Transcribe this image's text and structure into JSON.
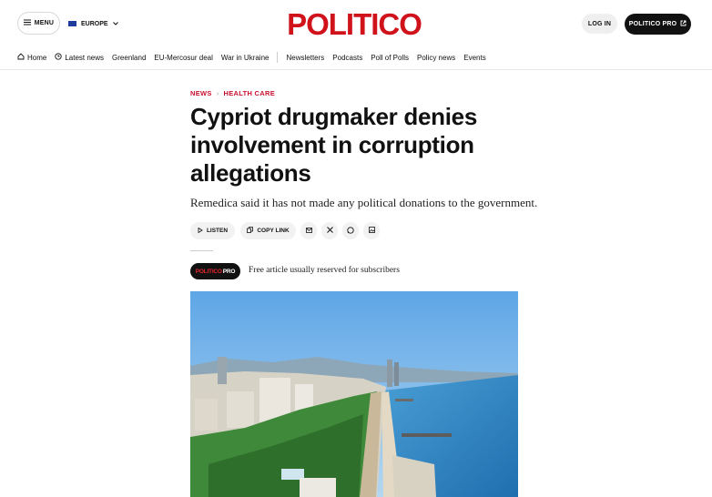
{
  "header": {
    "menu_label": "MENU",
    "region_label": "EUROPE",
    "logo_text": "POLITICO",
    "login_label": "LOG IN",
    "pro_label": "POLITICO PRO"
  },
  "nav": {
    "items": [
      "Home",
      "Latest news",
      "Greenland",
      "EU-Mercosur deal",
      "War in Ukraine",
      "Newsletters",
      "Podcasts",
      "Poll of Polls",
      "Policy news",
      "Events"
    ]
  },
  "article": {
    "breadcrumb": [
      "NEWS",
      "HEALTH CARE"
    ],
    "headline": "Cypriot drugmaker denies involvement in corruption allegations",
    "dek": "Remedica said it has not made any political donations to the government.",
    "listen_label": "LISTEN",
    "copy_link_label": "COPY LINK",
    "pro_badge": {
      "red": "POLITICO",
      "white": "PRO"
    },
    "free_note": "Free article usually reserved for subscribers"
  },
  "colors": {
    "brand_red": "#c8102e",
    "dark": "#111111",
    "sky": "#6aaee6",
    "sea": "#2d86c4"
  }
}
